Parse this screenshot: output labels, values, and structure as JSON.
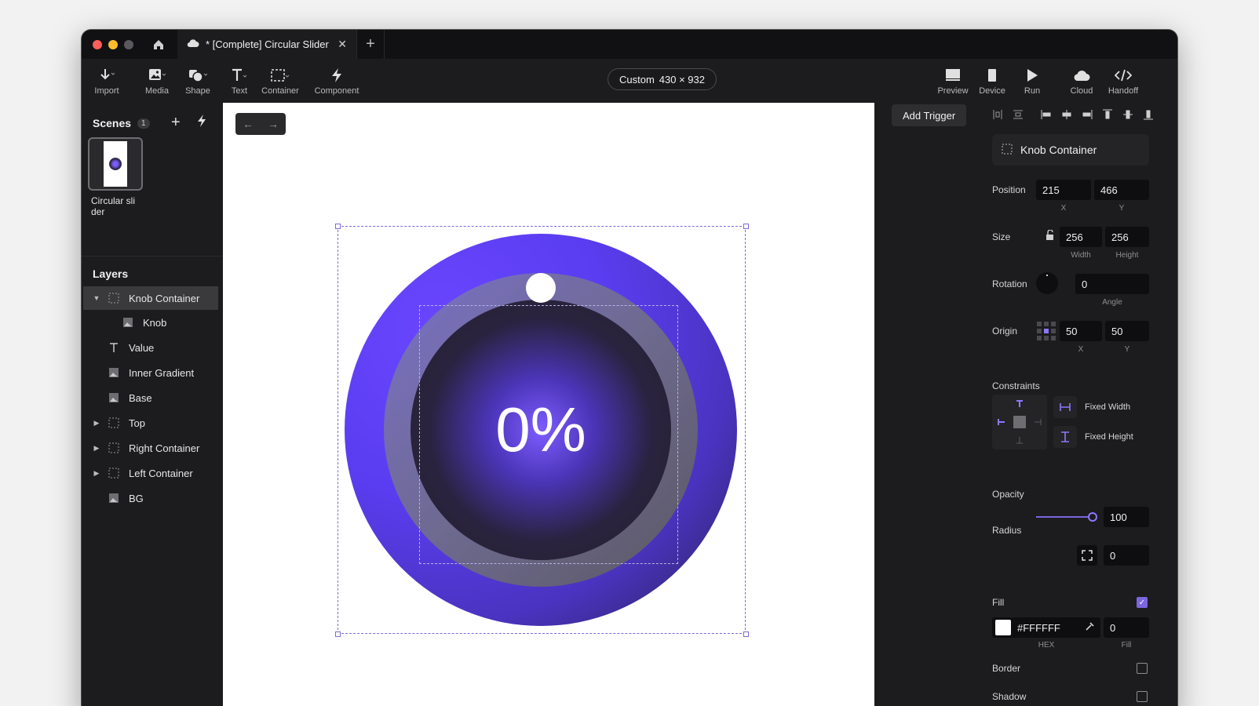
{
  "window": {
    "tab_title": "* [Complete] Circular Slider"
  },
  "toolbar": {
    "left_tools": [
      {
        "label": "Import",
        "icon": "import-icon"
      },
      {
        "label": "Media",
        "icon": "media-icon"
      },
      {
        "label": "Shape",
        "icon": "shape-icon"
      },
      {
        "label": "Text",
        "icon": "text-icon"
      },
      {
        "label": "Container",
        "icon": "container-icon"
      },
      {
        "label": "Component",
        "icon": "component-icon"
      }
    ],
    "device_label": "Custom",
    "device_size": "430 × 932",
    "right_tools": [
      {
        "label": "Preview",
        "icon": "preview-icon"
      },
      {
        "label": "Device",
        "icon": "device-icon"
      },
      {
        "label": "Run",
        "icon": "run-icon"
      },
      {
        "label": "Cloud",
        "icon": "cloud-icon"
      },
      {
        "label": "Handoff",
        "icon": "code-icon"
      }
    ]
  },
  "scenes": {
    "title": "Scenes",
    "count": "1",
    "items": [
      {
        "name": "Circular sli der"
      }
    ]
  },
  "layers": {
    "title": "Layers",
    "items": [
      {
        "name": "Knob Container",
        "icon": "container-icon",
        "expanded": true,
        "selected": true
      },
      {
        "name": "Knob",
        "icon": "image-layer-icon",
        "child": true
      },
      {
        "name": "Value",
        "icon": "text-icon"
      },
      {
        "name": "Inner Gradient",
        "icon": "image-layer-icon"
      },
      {
        "name": "Base",
        "icon": "image-layer-icon"
      },
      {
        "name": "Top",
        "icon": "container-icon",
        "collapsed": true
      },
      {
        "name": "Right Container",
        "icon": "container-icon",
        "collapsed": true
      },
      {
        "name": "Left Container",
        "icon": "container-icon",
        "collapsed": true
      },
      {
        "name": "BG",
        "icon": "image-layer-icon"
      }
    ]
  },
  "canvas": {
    "value_text": "0%",
    "knob_level": 0,
    "colors": {
      "accent": "#6a46ff",
      "ring": "#6e6a90",
      "inner": "#222228",
      "knob": "#ffffff"
    }
  },
  "properties": {
    "add_trigger": "Add Trigger",
    "layer_name": "Knob Container",
    "position_label": "Position",
    "position_x": "215",
    "position_y": "466",
    "x_label": "X",
    "y_label": "Y",
    "size_label": "Size",
    "width": "256",
    "height": "256",
    "width_label": "Width",
    "height_label": "Height",
    "rotation_label": "Rotation",
    "angle": "0",
    "angle_label": "Angle",
    "origin_label": "Origin",
    "origin_x": "50",
    "origin_y": "50",
    "constraints_label": "Constraints",
    "fixed_width": "Fixed Width",
    "fixed_height": "Fixed Height",
    "opacity_label": "Opacity",
    "opacity": "100",
    "radius_label": "Radius",
    "radius": "0",
    "fill_label": "Fill",
    "fill_hex": "#FFFFFF",
    "fill_value": "0",
    "hex_label": "HEX",
    "fill_sub_label": "Fill",
    "border_label": "Border",
    "shadow_label": "Shadow",
    "accent_color": "#7b65e0"
  }
}
